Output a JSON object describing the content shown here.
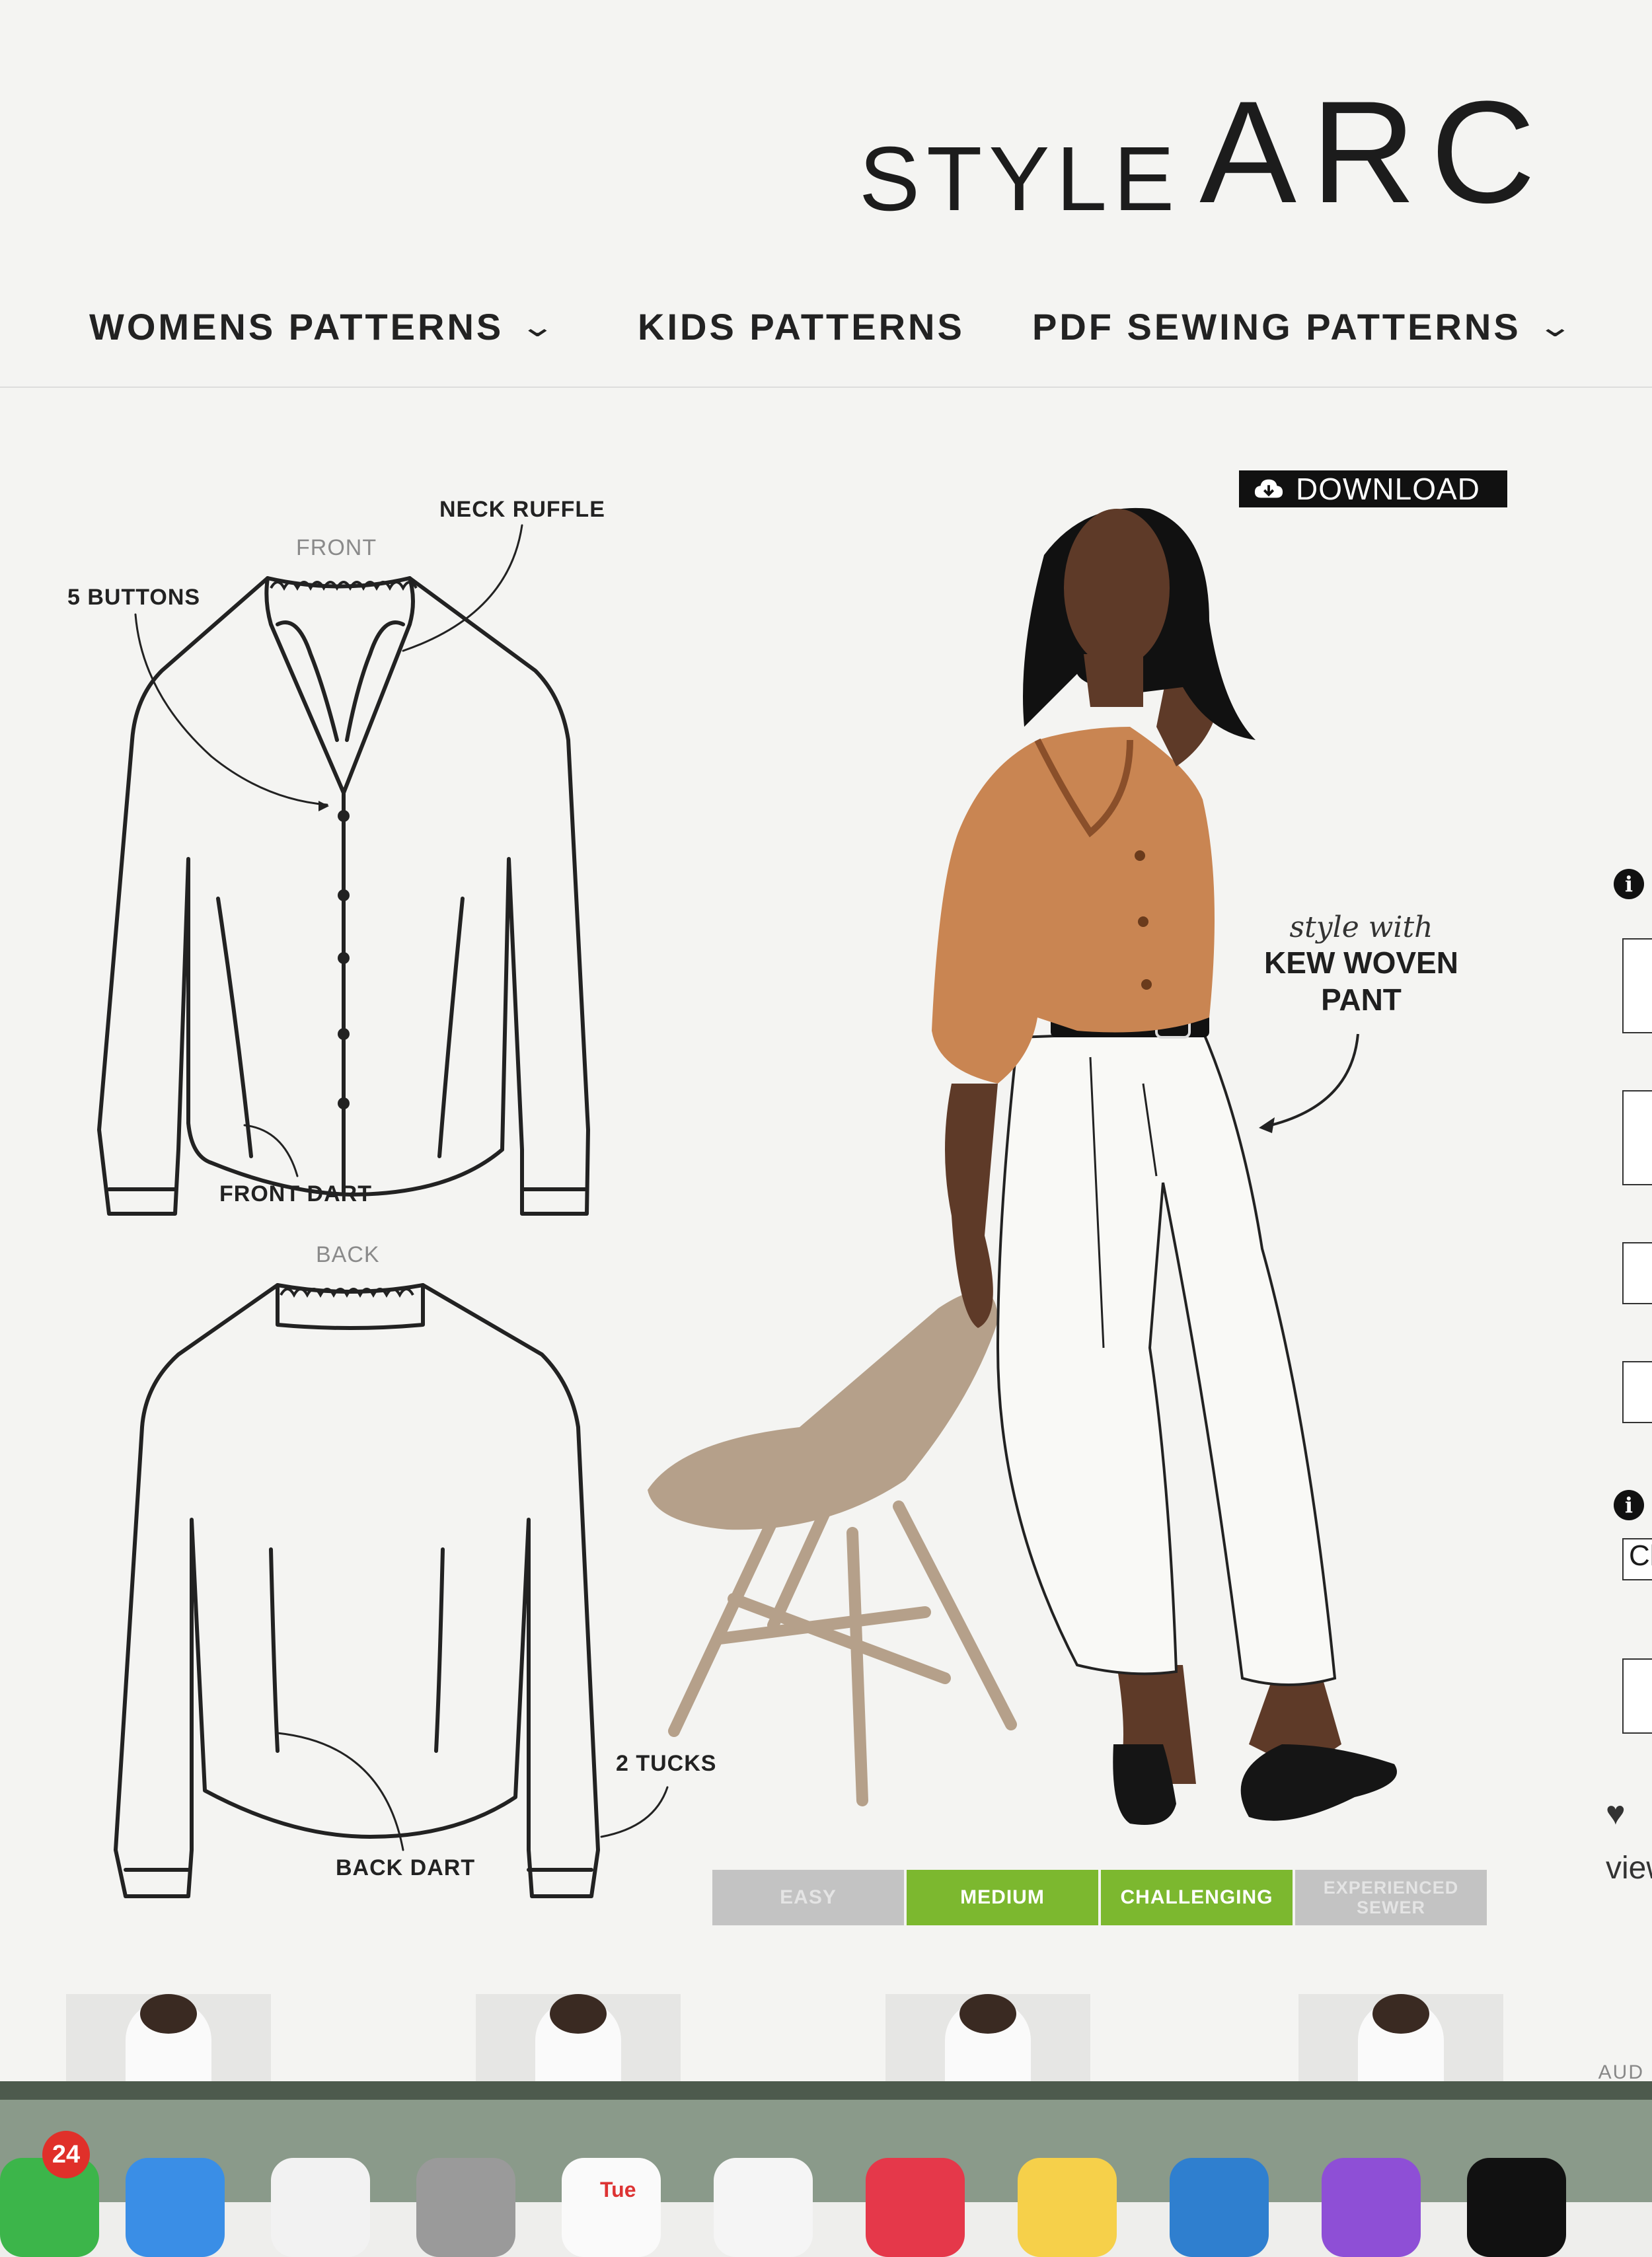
{
  "logo": {
    "style": "STYLE",
    "arc": "ARC"
  },
  "nav": {
    "items": [
      {
        "label": "WOMENS PATTERNS",
        "has_dropdown": true
      },
      {
        "label": "KIDS PATTERNS",
        "has_dropdown": false
      },
      {
        "label": "PDF SEWING PATTERNS",
        "has_dropdown": true
      }
    ]
  },
  "download_button": {
    "label": "DOWNLOAD",
    "icon": "cloud-download-icon"
  },
  "sketch_labels": {
    "neck_ruffle": "NECK RUFFLE",
    "front": "FRONT",
    "five_buttons": "5 BUTTONS",
    "front_dart": "FRONT DART",
    "back": "BACK",
    "two_tucks": "2 TUCKS",
    "back_dart": "BACK DART"
  },
  "style_with": {
    "script": "style with",
    "line1": "KEW WOVEN",
    "line2": "PANT"
  },
  "difficulty": {
    "levels": [
      {
        "label": "EASY",
        "active": false
      },
      {
        "label": "MEDIUM",
        "active": true
      },
      {
        "label": "CHALLENGING",
        "active": true
      },
      {
        "label": "EXPERIENCED SEWER",
        "active": false
      }
    ],
    "active_color": "#7cb82f",
    "inactive_color": "#c3c3c3"
  },
  "right_panel": {
    "partial_select": "Cl",
    "partial_text": "view",
    "partial_aud": "AUD"
  },
  "dock": {
    "notification_badge": "24",
    "calendar_day": "Tue"
  },
  "colors": {
    "shirt": "#c98552",
    "skin": "#5e3a28",
    "chair": "#b5a08a",
    "dock": "#8a9a8a"
  }
}
